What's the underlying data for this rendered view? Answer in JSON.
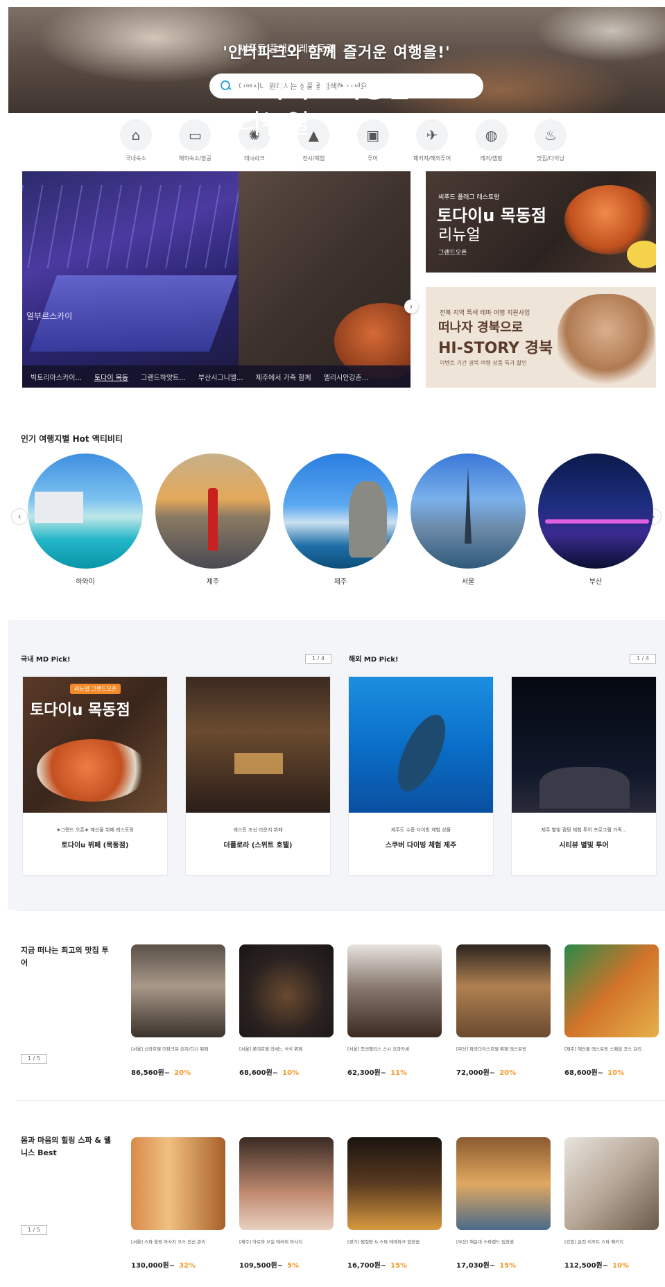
{
  "hero": {
    "title": "'인터파크와 함께 즐거운 여행을!'",
    "search_placeholder": "여행지나 원하시는 상품을 검색해 보세요"
  },
  "categories": [
    {
      "label": "국내숙소",
      "icon": "hotel-icon"
    },
    {
      "label": "해외숙소/항공",
      "icon": "bed-icon"
    },
    {
      "label": "테마파크",
      "icon": "ferris-wheel-icon"
    },
    {
      "label": "전시/체험",
      "icon": "chart-icon"
    },
    {
      "label": "투어",
      "icon": "bus-icon"
    },
    {
      "label": "패키지/해외투어",
      "icon": "plane-icon"
    },
    {
      "label": "레저/캠핑",
      "icon": "ticket-icon"
    },
    {
      "label": "맛집/다이닝",
      "icon": "dining-icon"
    }
  ],
  "main_banner": {
    "left_caption": "얼부르스카이",
    "subtitle": "씨푸드 플래그 레스토랑",
    "title": "토다이u 목동점",
    "title2": "리뉴얼",
    "small": "그랜드오픈",
    "tabs": [
      "빅토리아스카이...",
      "토다이 목동",
      "그랜드하얏트...",
      "부산시그니엘...",
      "제주에서 가족 함께",
      "엘리시안강촌..."
    ]
  },
  "side_banner_1": {
    "t1": "씨푸드 플래그 레스토랑",
    "t2": "토다이u 목동점",
    "t3": "리뉴얼",
    "t4": "그랜드오픈"
  },
  "side_banner_2": {
    "t1": "전북 지역 특색 테마 여행 지원사업",
    "t2": "떠나자 경북으로",
    "t3": "HI-STORY 경북",
    "t4": "이벤트 기간 경북 여행 상품 특가 할인"
  },
  "popular": {
    "title": "인기 여행지별 Hot 액티비티",
    "items": [
      "하와이",
      "제주",
      "제주",
      "서울",
      "부산"
    ]
  },
  "md_pick": {
    "domestic_title": "국내 MD Pick!",
    "overseas_title": "해외 MD Pick!",
    "nav": "1 / 4",
    "cards": [
      {
        "badge": "리뉴얼 그랜드오픈",
        "title_img": "토다이u 목동점",
        "desc": "★그랜드 오픈★ 해산물 뷔페 레스토랑",
        "name": "토다이u 뷔페 (목동점)"
      },
      {
        "desc": "웨스틴 조선 라운지 뷔페",
        "name": "더플로라 (스위트 호텔)"
      },
      {
        "desc": "제주도 수중 다이빙 체험 상품",
        "name": "스쿠버 다이빙 체험 제주"
      },
      {
        "desc": "제주 별빛 캠핑 체험 투어 프로그램 가족...",
        "name": "시티뷰 별빛 투어"
      }
    ]
  },
  "row1": {
    "title": "지금 떠나는 최고의 맛집 투어",
    "nav": "1 / 5",
    "products": [
      {
        "desc": "[서울] 신라호텔 더파크뷰 런치/디너 뷔페",
        "price": "86,560원~",
        "pct": "20%"
      },
      {
        "desc": "[서울] 롯데호텔 라세느 석식 뷔페",
        "price": "68,600원~",
        "pct": "10%"
      },
      {
        "desc": "[서울] 조선팰리스 스시 오마카세",
        "price": "62,300원~",
        "pct": "11%"
      },
      {
        "desc": "[부산] 파라다이스호텔 뷔페 레스토랑",
        "price": "72,000원~",
        "pct": "20%"
      },
      {
        "desc": "[제주] 해산물 레스토랑 스페셜 코스 요리",
        "price": "68,600원~",
        "pct": "10%"
      }
    ]
  },
  "row2": {
    "title": "몸과 마음의 힐링 스파 & 웰니스 Best",
    "nav": "1 / 5",
    "products": [
      {
        "desc": "[서울] 스파 힐링 마사지 코스 전신 관리",
        "price": "130,000원~",
        "pct": "32%"
      },
      {
        "desc": "[제주] 아로마 오일 테라피 마사지",
        "price": "109,500원~",
        "pct": "5%"
      },
      {
        "desc": "[경기] 찜질방 & 스파 테마파크 입장권",
        "price": "16,700원~",
        "pct": "15%"
      },
      {
        "desc": "[부산] 해운대 스파랜드 입장권",
        "price": "17,030원~",
        "pct": "15%"
      },
      {
        "desc": "[강원] 온천 리조트 스파 패키지",
        "price": "112,500원~",
        "pct": "10%"
      }
    ]
  }
}
